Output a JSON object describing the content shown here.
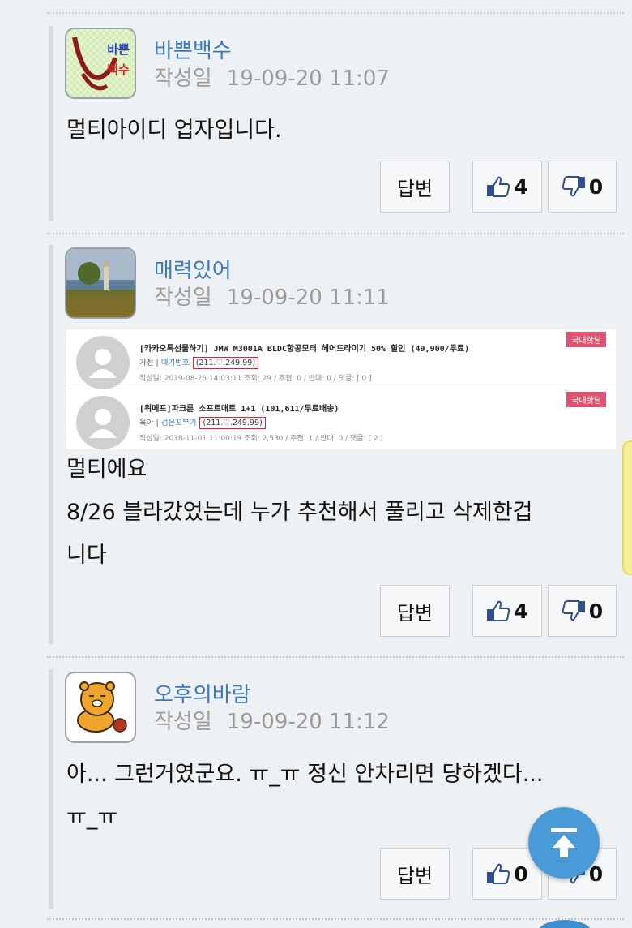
{
  "buttons": {
    "reply_label": "답변"
  },
  "comments": [
    {
      "author": "바쁜백수",
      "date_label": "작성일",
      "date": "19-09-20 11:07",
      "body": [
        "멀티아이디 업자입니다."
      ],
      "likes": "4",
      "dislikes": "0",
      "avatar_text": "바쁜\n백수"
    },
    {
      "author": "매력있어",
      "date_label": "작성일",
      "date": "19-09-20 11:11",
      "body": [
        "멀티에요",
        "8/26 블라갔었는데 누가 추천해서 풀리고 삭제한겁",
        "니다"
      ],
      "likes": "4",
      "dislikes": "0",
      "embedded": [
        {
          "title": "[카카오톡선물하기] JMW M3001A BLDC항공모터 헤어드라이기 50% 할인 (49,900/무료)",
          "category": "가전",
          "user": "대기번호",
          "ip": "(211.♡.249.99)",
          "info": "작성일: 2019-08-26 14:03:11     조회: 29  /  추천: 0  /  반대: 0  /  댓글: [ 0 ]",
          "tag": "국내핫딜"
        },
        {
          "title": "[위메프]파크론 소프트매트 1+1 (101,611/무료배송)",
          "category": "육아",
          "user": "검은꼬부기",
          "ip": "(211.♡.249.99)",
          "info": "작성일: 2018-11-01 11:00:19     조회: 2,530  /  추천: 1  /  반대: 0  /  댓글: [ 2 ]",
          "tag": "국내핫딜"
        }
      ]
    },
    {
      "author": "오후의바람",
      "date_label": "작성일",
      "date": "19-09-20 11:12",
      "body": [
        "아... 그런거였군요. ㅠ_ㅠ 정신 안차리면 당하겠다...",
        "ㅠ_ㅠ"
      ],
      "likes": "0",
      "dislikes": "0"
    }
  ],
  "icons": {
    "like": "thumbs-up-icon",
    "dislike": "thumbs-down-icon",
    "top": "arrow-up-to-top-icon"
  },
  "colors": {
    "author": "#3b78b8",
    "accent": "#4b9ad8",
    "tag": "#e0526f"
  }
}
